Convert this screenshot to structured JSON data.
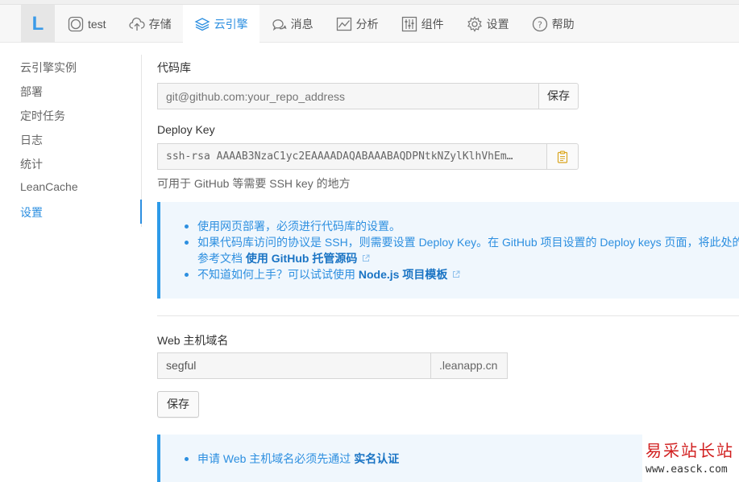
{
  "app": {
    "logo_letter": "L"
  },
  "nav": [
    {
      "label": "test",
      "icon": "app-circle-icon",
      "active": false
    },
    {
      "label": "存储",
      "icon": "cloud-upload-icon",
      "active": false
    },
    {
      "label": "云引擎",
      "icon": "layers-icon",
      "active": true
    },
    {
      "label": "消息",
      "icon": "chat-icon",
      "active": false
    },
    {
      "label": "分析",
      "icon": "chart-icon",
      "active": false
    },
    {
      "label": "组件",
      "icon": "sliders-icon",
      "active": false
    },
    {
      "label": "设置",
      "icon": "gear-icon",
      "active": false
    },
    {
      "label": "帮助",
      "icon": "help-icon",
      "active": false
    }
  ],
  "sidebar": {
    "items": [
      {
        "label": "云引擎实例"
      },
      {
        "label": "部署"
      },
      {
        "label": "定时任务"
      },
      {
        "label": "日志"
      },
      {
        "label": "统计"
      },
      {
        "label": "LeanCache"
      },
      {
        "label": "设置",
        "active": true
      }
    ]
  },
  "repo": {
    "label": "代码库",
    "placeholder": "git@github.com:your_repo_address",
    "save_label": "保存"
  },
  "deploy_key": {
    "label": "Deploy Key",
    "value": "ssh-rsa AAAAB3NzaC1yc2EAAAADAQABAAABAQDPNtkNZylKlhVhEm…",
    "help": "可用于 GitHub 等需要 SSH key 的地方"
  },
  "info_alert": {
    "line1": "使用网页部署，必须进行代码库的设置。",
    "line2": "如果代码库访问的协议是 SSH，则需要设置 Deploy Key。在 GitHub 项目设置的 Deploy keys 页面，将此处的 D",
    "line2b_prefix": "参考文档",
    "line2b_link": "使用 GitHub 托管源码",
    "line3_prefix": "不知道如何上手？可以试试使用",
    "line3_link": "Node.js 项目模板"
  },
  "web_host": {
    "label": "Web 主机域名",
    "value": "segful",
    "suffix": ".leanapp.cn",
    "save_label": "保存"
  },
  "host_alert": {
    "text_prefix": "申请 Web 主机域名必须先通过",
    "link": "实名认证"
  },
  "watermark": {
    "title": "易采站长站",
    "url": "www.easck.com"
  },
  "colors": {
    "accent": "#2d8fe0",
    "watermark": "#d11f1f"
  }
}
